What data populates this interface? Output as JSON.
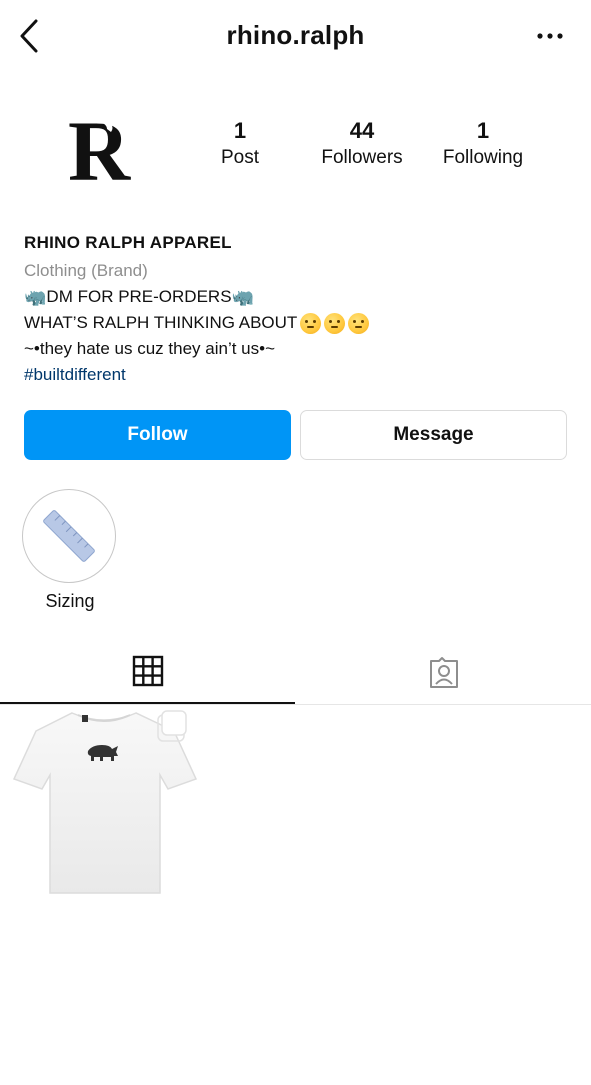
{
  "header": {
    "username": "rhino.ralph",
    "back_icon": "chevron-left-icon",
    "more_icon": "more-horizontal-icon"
  },
  "profile": {
    "avatar_letter": "R",
    "stats": [
      {
        "value": "1",
        "label": "Post"
      },
      {
        "value": "44",
        "label": "Followers"
      },
      {
        "value": "1",
        "label": "Following"
      }
    ]
  },
  "bio": {
    "name": "RHINO RALPH APPAREL",
    "category": "Clothing (Brand)",
    "line1": "DM FOR PRE-ORDERS",
    "line1_emoji": "🦏",
    "line2": "WHAT’S RALPH THINKING ABOUT",
    "line3": "~•they hate us cuz they ain’t us•~",
    "hashtag": "#builtdifferent"
  },
  "actions": {
    "follow_label": "Follow",
    "message_label": "Message"
  },
  "highlights": [
    {
      "label": "Sizing"
    }
  ],
  "tabs": [
    {
      "icon": "grid-icon",
      "active": true
    },
    {
      "icon": "tagged-user-icon",
      "active": false
    }
  ],
  "colors": {
    "follow_blue": "#0095f6",
    "hashtag": "#00376b",
    "muted": "#8e8e8e"
  }
}
